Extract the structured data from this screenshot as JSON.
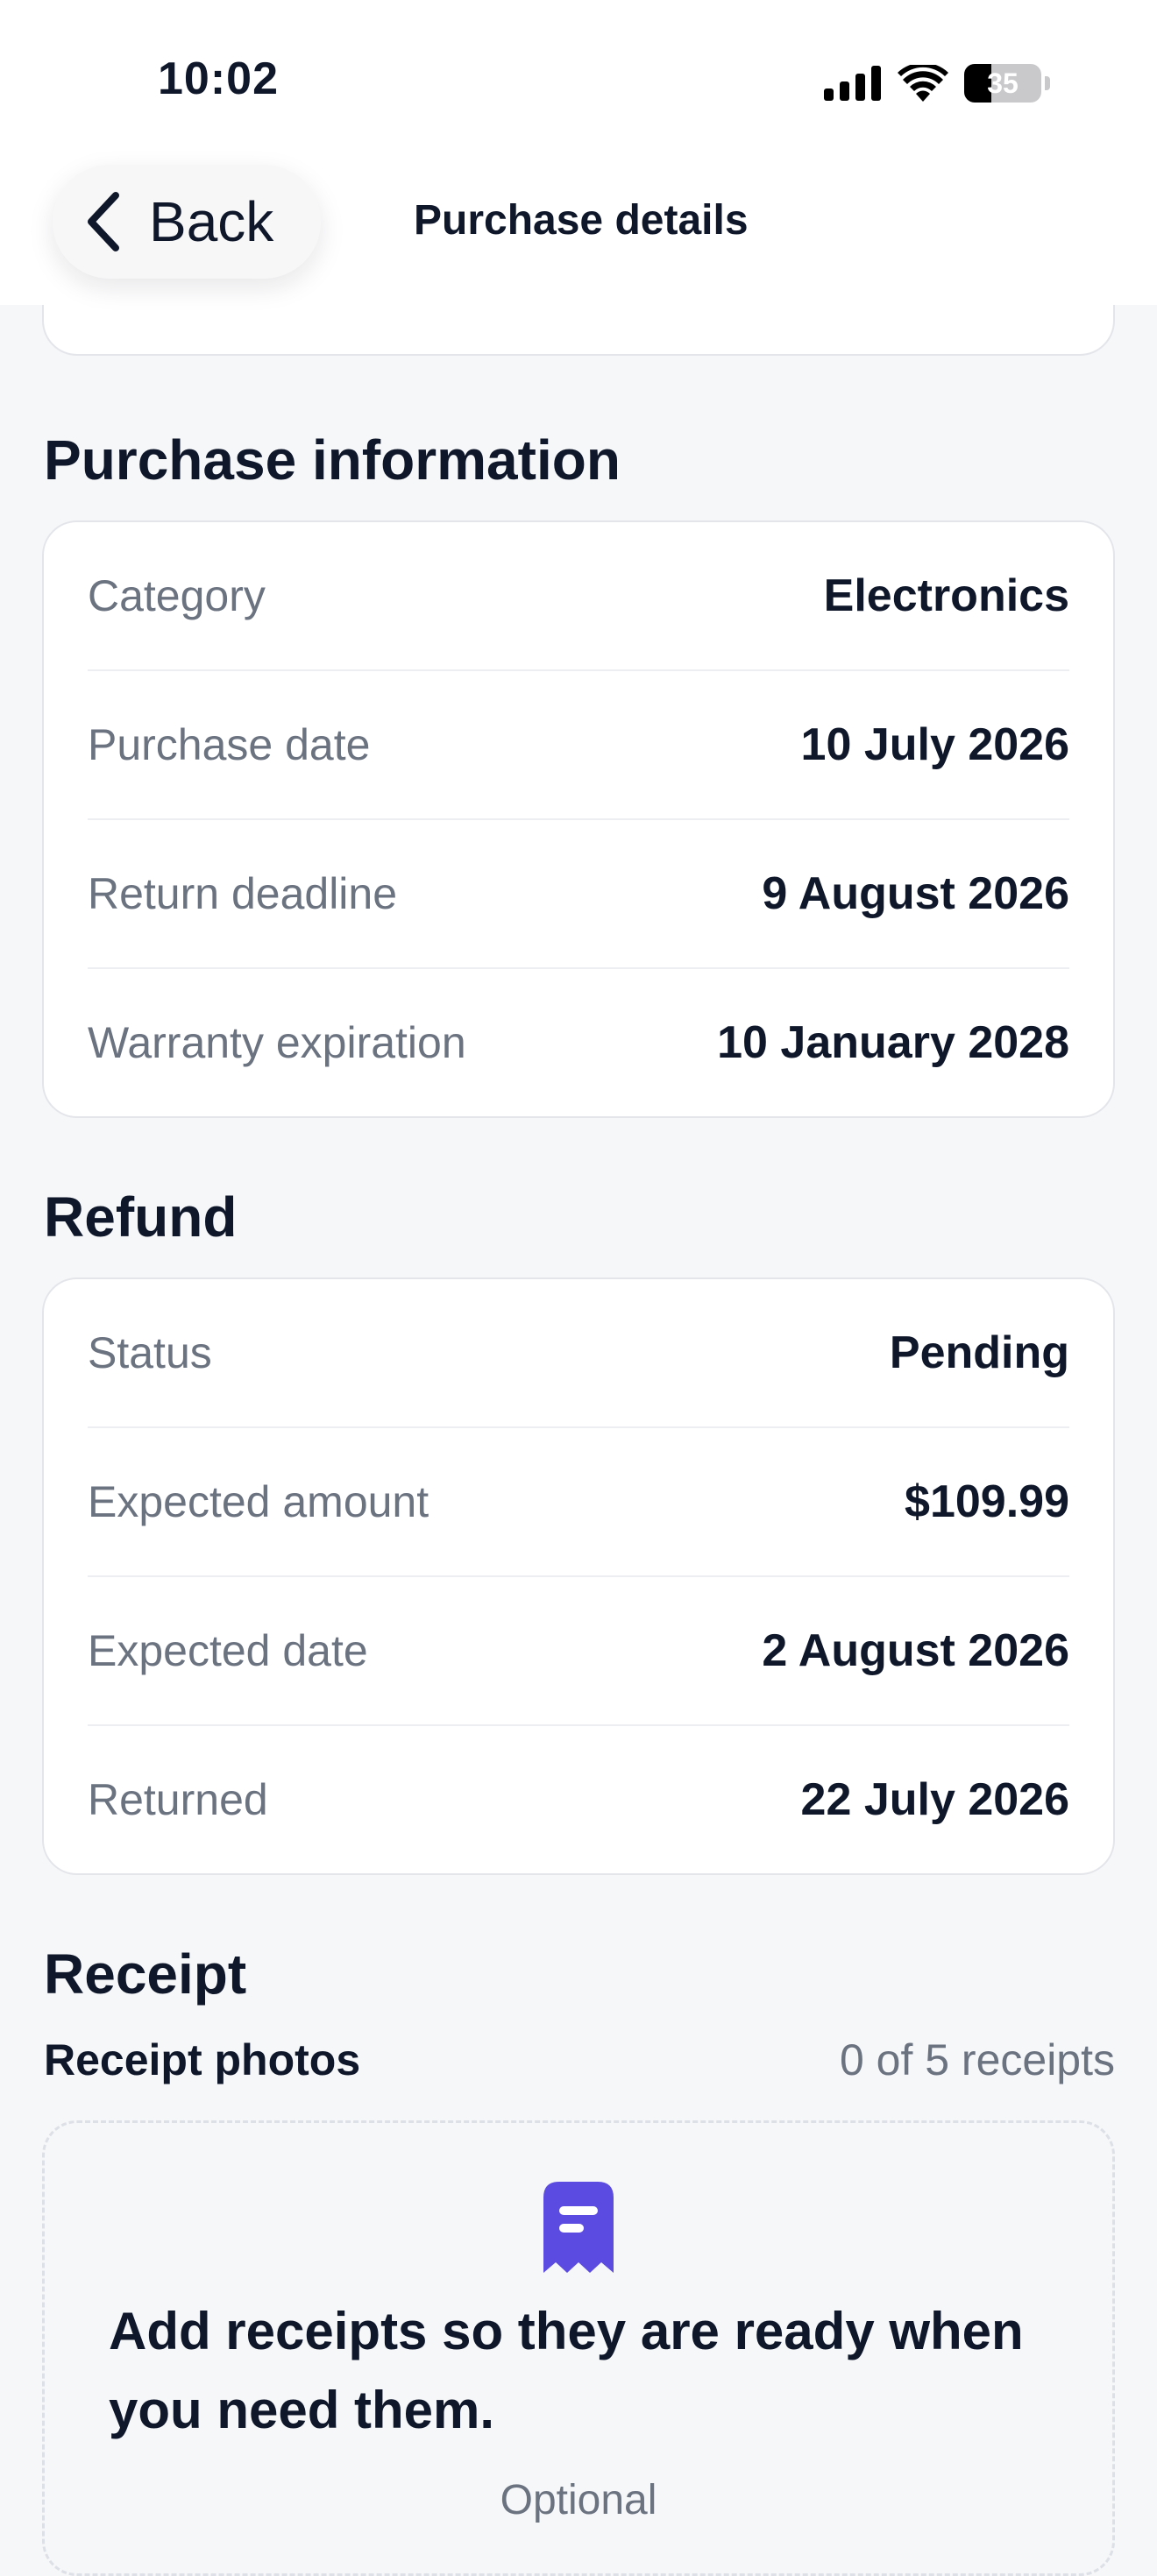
{
  "status_bar": {
    "time": "10:02",
    "battery_percent": "35",
    "icons": [
      "cellular-signal-icon",
      "wifi-icon",
      "battery-icon"
    ]
  },
  "nav": {
    "back_label": "Back",
    "title": "Purchase details",
    "back_icon": "chevron-left-icon"
  },
  "purchase_info": {
    "title": "Purchase information",
    "rows": [
      {
        "label": "Category",
        "value": "Electronics"
      },
      {
        "label": "Purchase date",
        "value": "10 July 2026"
      },
      {
        "label": "Return deadline",
        "value": "9 August 2026"
      },
      {
        "label": "Warranty expiration",
        "value": "10 January 2028"
      }
    ]
  },
  "refund": {
    "title": "Refund",
    "rows": [
      {
        "label": "Status",
        "value": "Pending"
      },
      {
        "label": "Expected amount",
        "value": "$109.99"
      },
      {
        "label": "Expected date",
        "value": "2 August 2026"
      },
      {
        "label": "Returned",
        "value": "22 July 2026"
      }
    ]
  },
  "receipt": {
    "title": "Receipt",
    "subtitle": "Receipt photos",
    "count": "0 of 5 receipts",
    "empty_icon": "receipt-icon",
    "empty_text": "Add receipts so they are ready when you need them.",
    "optional_label": "Optional"
  },
  "colors": {
    "accent": "#5b4be0",
    "background": "#f6f7f9",
    "text_primary": "#0f172a",
    "text_secondary": "#6b7280"
  }
}
